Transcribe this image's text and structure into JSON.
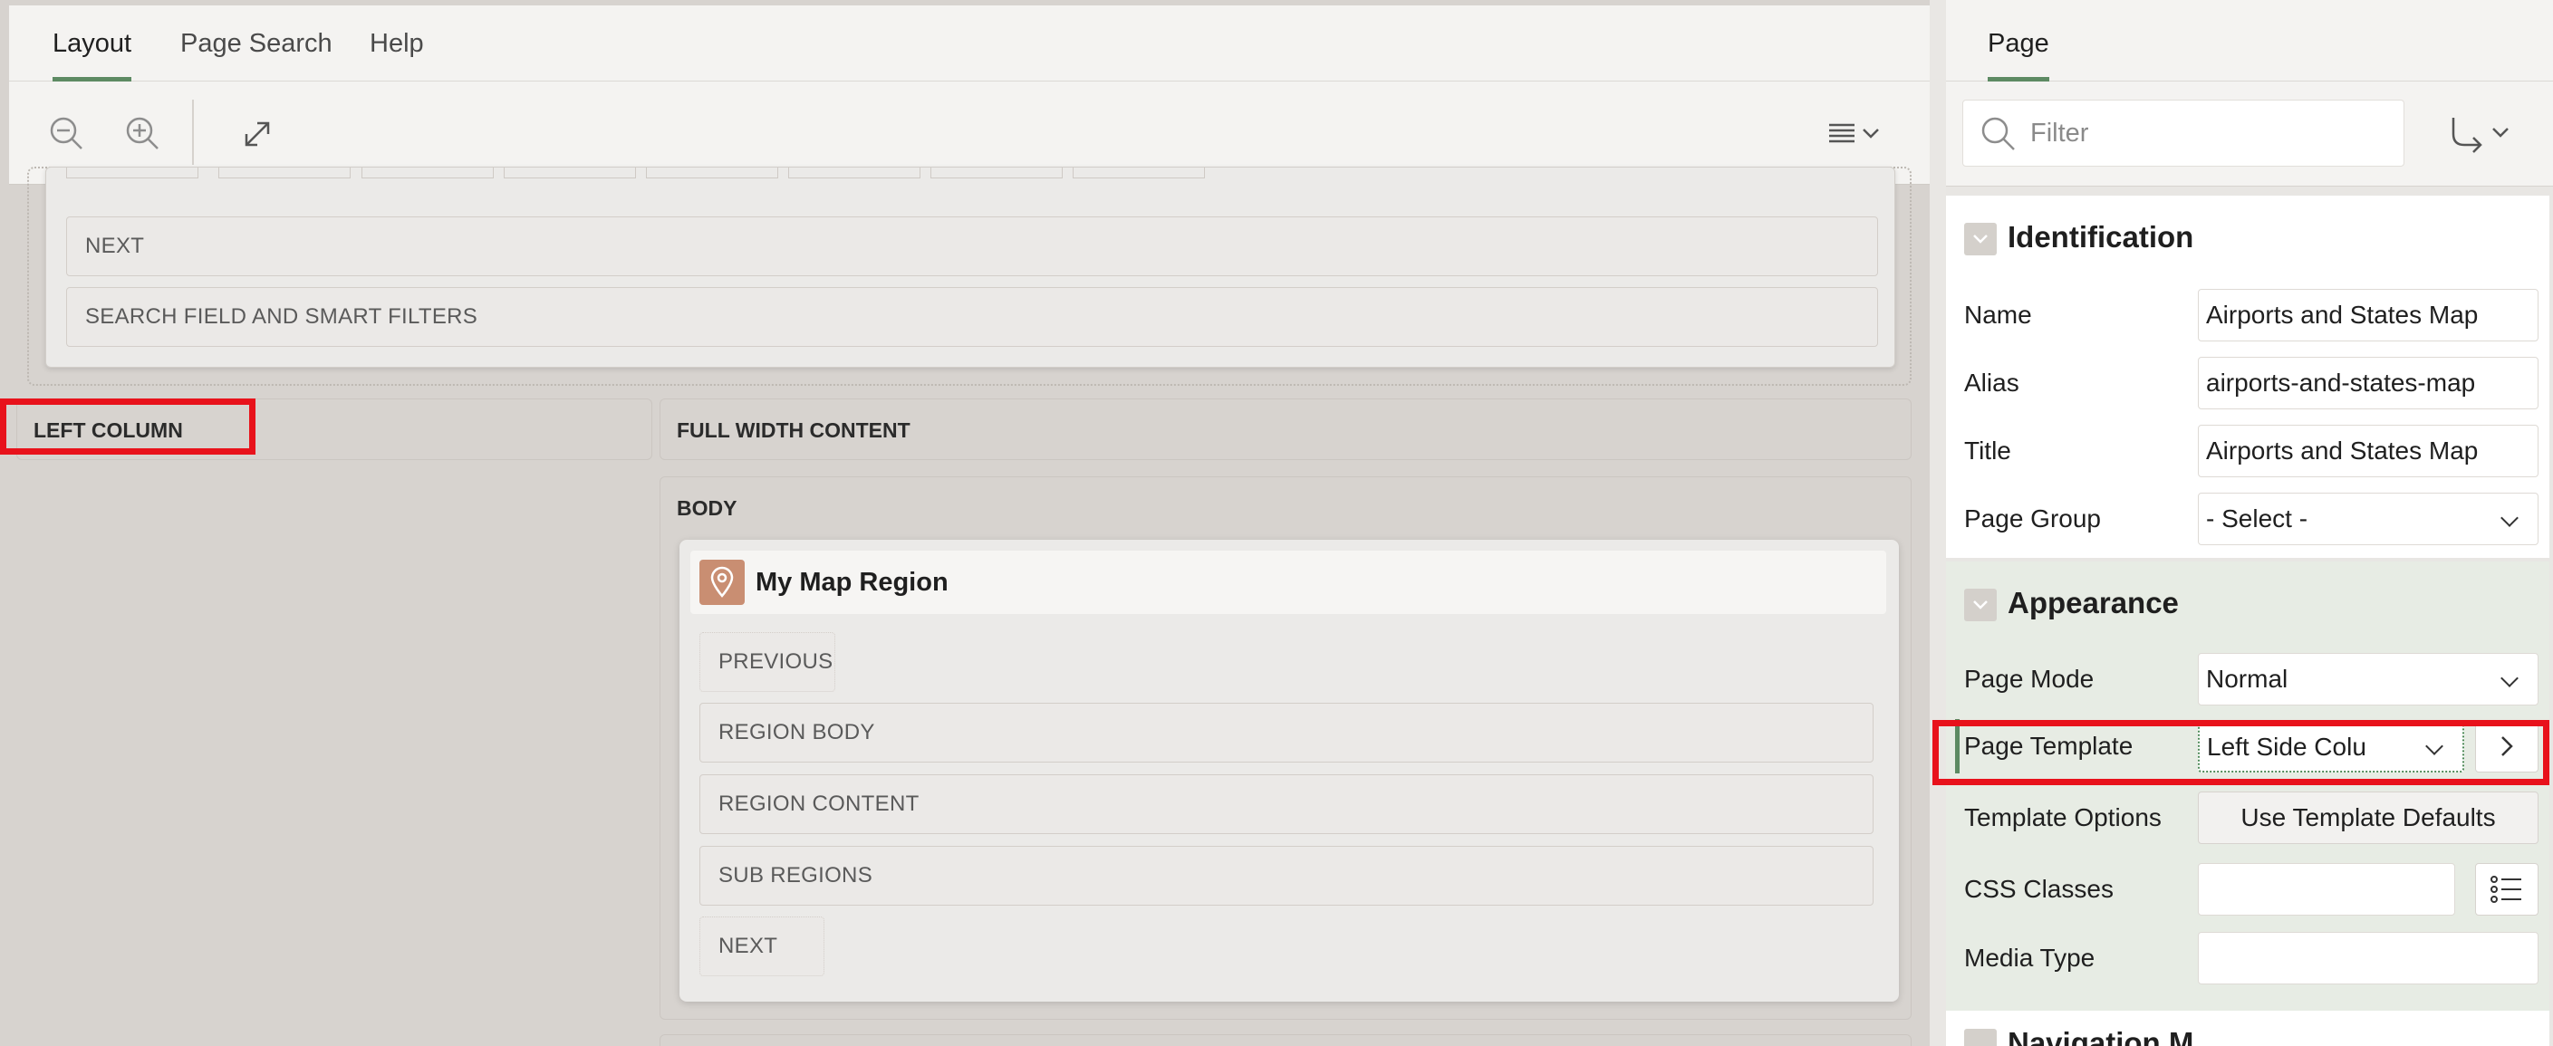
{
  "left_tabs": {
    "layout": "Layout",
    "page_search": "Page Search",
    "help": "Help"
  },
  "right_tabs": {
    "page": "Page"
  },
  "layout_canvas": {
    "top_slots": {
      "next": "NEXT",
      "search": "SEARCH FIELD AND SMART FILTERS"
    },
    "left_column": "LEFT COLUMN",
    "full_width_content": "FULL WIDTH CONTENT",
    "body": "BODY",
    "region": {
      "title": "My Map Region",
      "icon": "map-pin-icon",
      "slots": [
        "PREVIOUS",
        "REGION BODY",
        "REGION CONTENT",
        "SUB REGIONS",
        "NEXT"
      ]
    }
  },
  "filter": {
    "placeholder": "Filter"
  },
  "identification": {
    "title": "Identification",
    "name_label": "Name",
    "name_value": "Airports and States Map",
    "alias_label": "Alias",
    "alias_value": "airports-and-states-map",
    "title_label": "Title",
    "title_value": "Airports and States Map",
    "page_group_label": "Page Group",
    "page_group_value": "- Select -"
  },
  "appearance": {
    "title": "Appearance",
    "page_mode_label": "Page Mode",
    "page_mode_value": "Normal",
    "page_template_label": "Page Template",
    "page_template_value": "Left Side Colu",
    "template_options_label": "Template Options",
    "template_options_button": "Use Template Defaults",
    "css_classes_label": "CSS Classes",
    "media_type_label": "Media Type"
  },
  "next_section_partial": "Navigation M",
  "colors": {
    "accent": "#5d8a63",
    "highlight": "#e8121b",
    "map_icon_bg": "#c98e72"
  }
}
